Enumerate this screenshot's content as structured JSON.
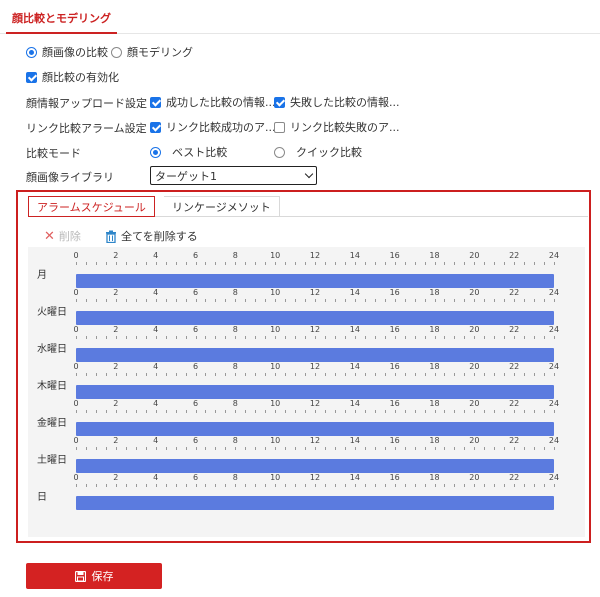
{
  "tab": {
    "label": "顔比較とモデリング"
  },
  "mode": {
    "compare_label": "顔画像の比較",
    "modeling_label": "顔モデリング"
  },
  "enable": {
    "label": "顔比較の有効化"
  },
  "upload": {
    "label": "顔情報アップロード設定",
    "opt1": "成功した比較の情報...",
    "opt2": "失敗した比較の情報..."
  },
  "link_alarm": {
    "label": "リンク比較アラーム設定",
    "opt1": "リンク比較成功のア...",
    "opt2": "リンク比較失敗のア..."
  },
  "compare_mode": {
    "label": "比較モード",
    "opt1": "ベスト比較",
    "opt2": "クイック比較"
  },
  "library": {
    "label": "顔画像ライブラリ",
    "value": "ターゲット1"
  },
  "subtabs": {
    "schedule": "アラームスケジュール",
    "linkage": "リンケージメソット"
  },
  "toolbar": {
    "delete": "削除",
    "delete_all": "全てを削除する"
  },
  "schedule": {
    "hours": [
      "0",
      "2",
      "4",
      "6",
      "8",
      "10",
      "12",
      "14",
      "16",
      "18",
      "20",
      "22",
      "24"
    ],
    "days": [
      "月",
      "火曜日",
      "水曜日",
      "木曜日",
      "金曜日",
      "土曜日",
      "日"
    ],
    "coverage": [
      [
        0,
        24
      ],
      [
        0,
        24
      ],
      [
        0,
        24
      ],
      [
        0,
        24
      ],
      [
        0,
        24
      ],
      [
        0,
        24
      ],
      [
        0,
        24
      ]
    ]
  },
  "save": {
    "label": "保存"
  },
  "colors": {
    "accent": "#cc2222",
    "bar": "#5b7bdf",
    "check": "#1a73e8"
  }
}
